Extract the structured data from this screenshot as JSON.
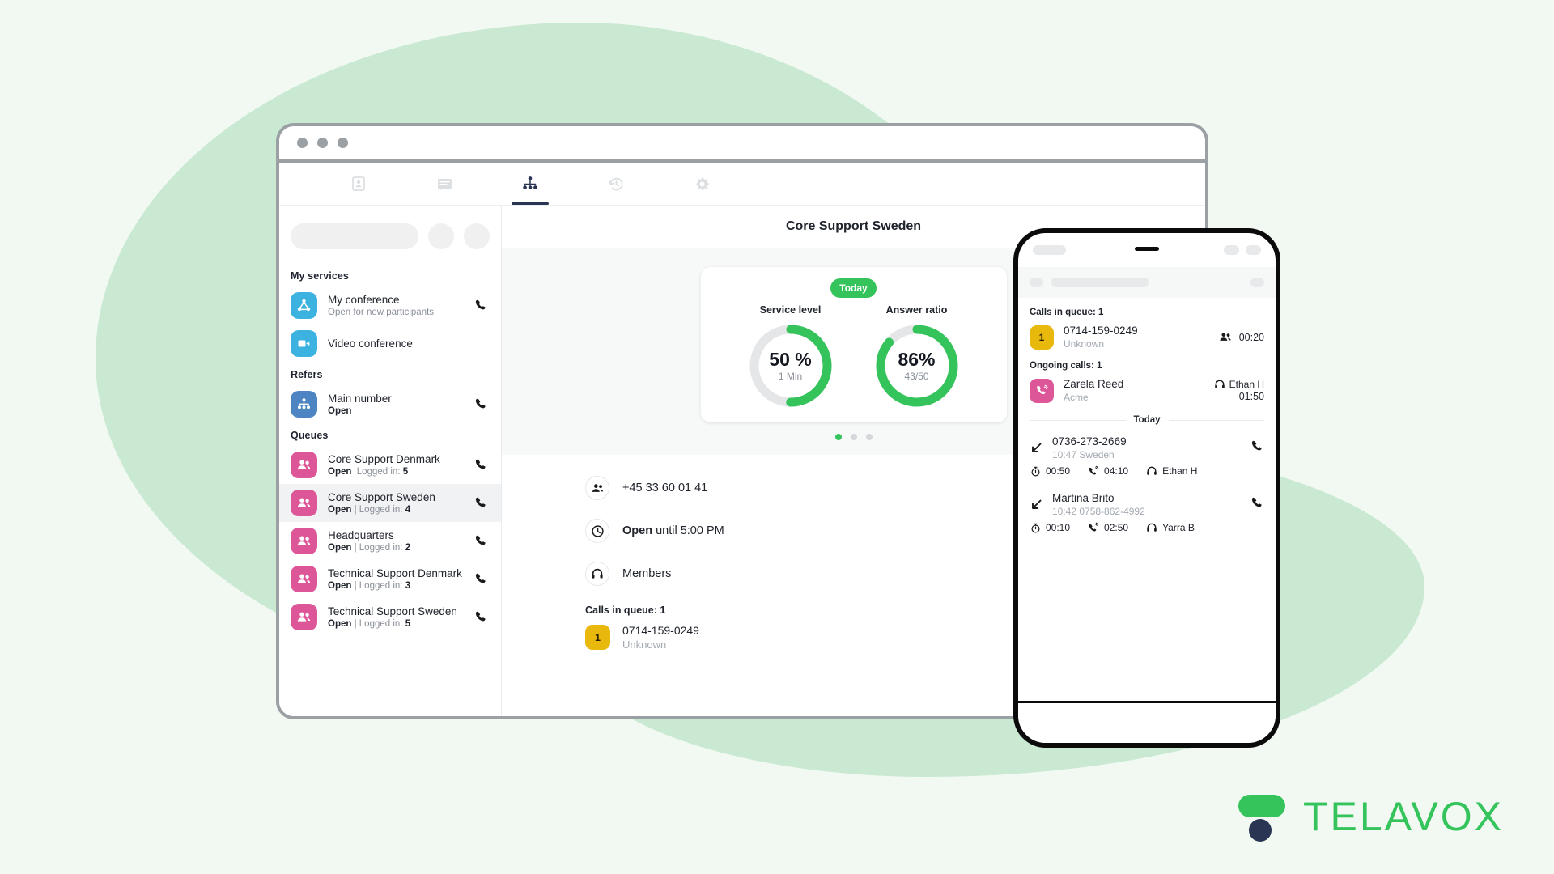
{
  "brand": {
    "name": "TELAVOX",
    "green": "#35C45B",
    "navy": "#2A3553"
  },
  "desktop": {
    "tabs": [
      {
        "name": "contacts",
        "icon": "contact-card-icon",
        "active": false
      },
      {
        "name": "chat",
        "icon": "chat-bubble-icon",
        "active": false
      },
      {
        "name": "organisation",
        "icon": "org-chart-icon",
        "active": true
      },
      {
        "name": "history",
        "icon": "history-clock-icon",
        "active": false
      },
      {
        "name": "settings",
        "icon": "gear-icon",
        "active": false
      }
    ],
    "sidebar": {
      "groups": [
        {
          "title": "My services",
          "items": [
            {
              "name": "My conference",
              "sub_prefix": "",
              "sub": "Open for new participants",
              "sub_count": "",
              "avatar": "av-blue",
              "icon": "conference-icon",
              "call": true
            },
            {
              "name": "Video conference",
              "sub_prefix": "",
              "sub": "",
              "sub_count": "",
              "avatar": "av-blue",
              "icon": "video-camera-icon",
              "call": false
            }
          ]
        },
        {
          "title": "Refers",
          "items": [
            {
              "name": "Main number",
              "sub_prefix": "Open",
              "sub": "",
              "sub_count": "",
              "avatar": "av-navy",
              "icon": "org-chart-icon",
              "call": true
            }
          ]
        },
        {
          "title": "Queues",
          "items": [
            {
              "name": "Core Support Denmark",
              "sub_prefix": "Open",
              "sub": "Logged in:",
              "sub_count": "5",
              "avatar": "av-pink",
              "icon": "people-icon",
              "call": true,
              "selected": false
            },
            {
              "name": "Core Support Sweden",
              "sub_prefix": "Open",
              "sub": "| Logged in:",
              "sub_count": "4",
              "avatar": "av-pink",
              "icon": "people-icon",
              "call": true,
              "selected": true
            },
            {
              "name": "Headquarters",
              "sub_prefix": "Open",
              "sub": "| Logged in:",
              "sub_count": "2",
              "avatar": "av-pink",
              "icon": "people-icon",
              "call": true,
              "selected": false
            },
            {
              "name": "Technical Support Denmark",
              "sub_prefix": "Open",
              "sub": "| Logged in:",
              "sub_count": "3",
              "avatar": "av-pink",
              "icon": "people-icon",
              "call": true,
              "selected": false
            },
            {
              "name": "Technical Support Sweden",
              "sub_prefix": "Open",
              "sub": "| Logged in:",
              "sub_count": "5",
              "avatar": "av-pink",
              "icon": "people-icon",
              "call": true,
              "selected": false
            }
          ]
        }
      ]
    },
    "main": {
      "title": "Core Support Sweden",
      "stats_period": "Today",
      "carousel": {
        "total": 3,
        "active": 1
      },
      "details": [
        {
          "icon": "people-icon",
          "text_bold": "",
          "text": "+45 33 60 01 41"
        },
        {
          "icon": "clock-icon",
          "text_bold": "Open",
          "text": " until 5:00 PM"
        },
        {
          "icon": "headset-icon",
          "text_bold": "",
          "text": "Members"
        }
      ],
      "queue_heading": "Calls in queue: 1",
      "queue_item": {
        "badge": "1",
        "number": "0714-159-0249",
        "caller": "Unknown"
      }
    }
  },
  "chart_data": [
    {
      "type": "pie",
      "title": "Service level",
      "value_label": "50 %",
      "sub_label": "1 Min",
      "percent": 50,
      "colors": {
        "filled": "#35C45B",
        "track": "#E4E6E7"
      }
    },
    {
      "type": "pie",
      "title": "Answer ratio",
      "value_label": "86%",
      "sub_label": "43/50",
      "percent": 86,
      "answered": 43,
      "total": 50,
      "colors": {
        "filled": "#35C45B",
        "track": "#E4E6E7"
      }
    }
  ],
  "phone": {
    "queue_heading": "Calls in queue: 1",
    "queue_items": [
      {
        "badge": "1",
        "number": "0714-159-0249",
        "caller": "Unknown",
        "icon": "people-icon",
        "time": "00:20"
      }
    ],
    "ongoing_heading": "Ongoing calls: 1",
    "ongoing_items": [
      {
        "name": "Zarela Reed",
        "company": "Acme",
        "icon": "active-call-icon",
        "agent": "Ethan H",
        "time": "01:50"
      }
    ],
    "history_label": "Today",
    "history": [
      {
        "direction_icon": "incoming-call-arrow-icon",
        "name": "0736-273-2669",
        "sub": "10:47 Sweden",
        "wait": "00:50",
        "duration": "04:10",
        "agent": "Ethan H",
        "call_icon": "phone-icon"
      },
      {
        "direction_icon": "incoming-call-arrow-icon",
        "name": "Martina Brito",
        "sub": "10:42 0758-862-4992",
        "wait": "00:10",
        "duration": "02:50",
        "agent": "Yarra B",
        "call_icon": "phone-icon"
      }
    ]
  }
}
